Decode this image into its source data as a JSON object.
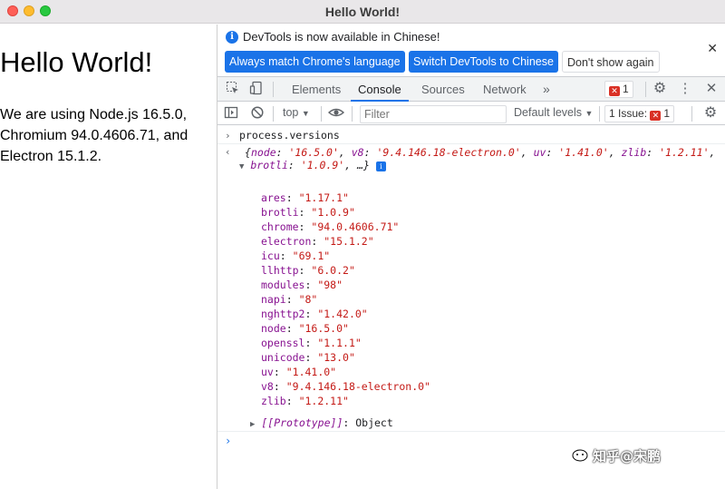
{
  "window": {
    "title": "Hello World!"
  },
  "page": {
    "heading": "Hello World!",
    "paragraph": "We are using Node.js 16.5.0, Chromium 94.0.4606.71, and Electron 15.1.2."
  },
  "devtools": {
    "infobar": {
      "message": "DevTools is now available in Chinese!",
      "btn_match": "Always match Chrome's language",
      "btn_switch": "Switch DevTools to Chinese",
      "btn_dismiss": "Don't show again"
    },
    "tabs": [
      "Elements",
      "Console",
      "Sources",
      "Network"
    ],
    "active_tab": "Console",
    "error_count": "1",
    "toolbar": {
      "context": "top",
      "filter_placeholder": "Filter",
      "levels": "Default levels",
      "issues": "1 Issue:",
      "issues_count": "1"
    },
    "console": {
      "command": "process.versions",
      "summary": {
        "node": "'16.5.0'",
        "v8": "'9.4.146.18-electron.0'",
        "uv": "'1.41.0'",
        "zlib": "'1.2.11'",
        "brotli": "'1.0.9'"
      },
      "entries": [
        {
          "key": "ares",
          "value": "\"1.17.1\""
        },
        {
          "key": "brotli",
          "value": "\"1.0.9\""
        },
        {
          "key": "chrome",
          "value": "\"94.0.4606.71\""
        },
        {
          "key": "electron",
          "value": "\"15.1.2\""
        },
        {
          "key": "icu",
          "value": "\"69.1\""
        },
        {
          "key": "llhttp",
          "value": "\"6.0.2\""
        },
        {
          "key": "modules",
          "value": "\"98\""
        },
        {
          "key": "napi",
          "value": "\"8\""
        },
        {
          "key": "nghttp2",
          "value": "\"1.42.0\""
        },
        {
          "key": "node",
          "value": "\"16.5.0\""
        },
        {
          "key": "openssl",
          "value": "\"1.1.1\""
        },
        {
          "key": "unicode",
          "value": "\"13.0\""
        },
        {
          "key": "uv",
          "value": "\"1.41.0\""
        },
        {
          "key": "v8",
          "value": "\"9.4.146.18-electron.0\""
        },
        {
          "key": "zlib",
          "value": "\"1.2.11\""
        }
      ],
      "prototype_key": "[[Prototype]]",
      "prototype_value": "Object"
    }
  },
  "watermark": "知乎@宋鹏"
}
